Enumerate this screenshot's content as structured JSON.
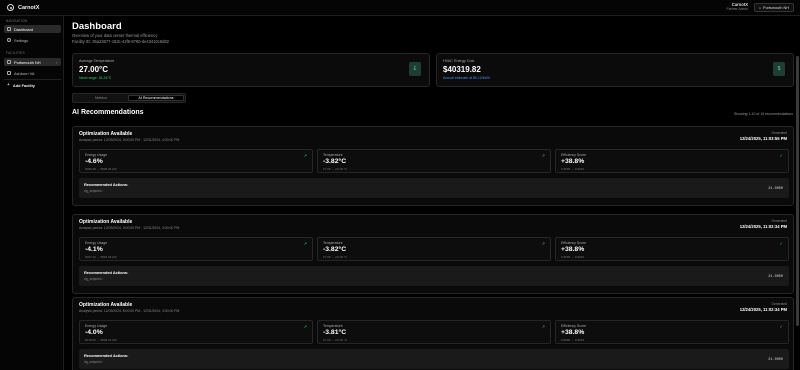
{
  "app": {
    "name": "CarnotX"
  },
  "user": {
    "name": "CarnotX",
    "role": "Partner Admin"
  },
  "facility_selector": {
    "label": "Portsmouth NH"
  },
  "sidebar": {
    "navigation_title": "NAVIGATION",
    "nav": [
      {
        "label": "Dashboard",
        "icon": "dashboard-icon",
        "active": true
      },
      {
        "label": "Settings",
        "icon": "settings-icon",
        "active": false
      }
    ],
    "facilities_title": "FACILITIES",
    "facilities": [
      {
        "label": "Portsmouth NH",
        "icon": "building-icon",
        "active": true
      },
      {
        "label": "Ashburn VA",
        "icon": "building-icon",
        "active": false
      }
    ],
    "add_facility": "Add Facility"
  },
  "header": {
    "title": "Dashboard",
    "subtitle": "Overview of your data center thermal efficiency",
    "facility_id": "Facility ID: 35a23677-153c-42f8-8780-de43410c9d82"
  },
  "stats": [
    {
      "label": "Average Temperature",
      "value": "27.00°C",
      "note": "Ideal range: 18-24°C",
      "note_color": "#3ec46d",
      "badge": "£"
    },
    {
      "label": "HVAC Energy Cost",
      "value": "$40319.82",
      "note": "Annual estimate at $0.12/kWh",
      "note_color": "#4f8ff0",
      "badge": "$"
    }
  ],
  "tabs": [
    {
      "label": "Metrics",
      "active": false
    },
    {
      "label": "AI Recommendations",
      "active": true
    }
  ],
  "recommendations": {
    "title": "AI Recommendations",
    "count_text": "Showing 1-10 of 19 recommendations",
    "cards": [
      {
        "title": "Optimization Available",
        "period": "Analysis period: 12/03/2024, 9:00:00 PM - 12/31/2024, 4:00:00 PM",
        "generated_label": "Generated",
        "generated_time": "12/24/2025, 11:03:55 PM",
        "metrics": [
          {
            "label": "Energy Usage",
            "value": "-4.6%",
            "range": "6080.48 → 5805.32 kW"
          },
          {
            "label": "Temperature",
            "value": "-3.82°C",
            "range": "27.00 → 23.18 °C"
          },
          {
            "label": "Efficiency Score",
            "value": "+38.8%",
            "range": "0.6593 → 0.9156"
          }
        ],
        "actions_title": "Recommended Actions:",
        "actions_text": "rtg_setpoint=",
        "actions_value": "21.0000"
      },
      {
        "title": "Optimization Available",
        "period": "Analysis period: 12/03/2024, 9:00:00 PM - 12/31/2024, 3:00:00 PM",
        "generated_label": "Generated",
        "generated_time": "12/24/2025, 11:02:34 PM",
        "metrics": [
          {
            "label": "Energy Usage",
            "value": "-4.1%",
            "range": "6067.44 → 5819.18 kW"
          },
          {
            "label": "Temperature",
            "value": "-3.82°C",
            "range": "27.00 → 23.18 °C"
          },
          {
            "label": "Efficiency Score",
            "value": "+38.8%",
            "range": "0.6593 → 0.9156"
          }
        ],
        "actions_title": "Recommended Actions:",
        "actions_text": "rtg_setpoint=",
        "actions_value": "21.0000"
      },
      {
        "title": "Optimization Available",
        "period": "Analysis period: 12/03/2024, 8:00:00 PM - 12/31/2024, 3:00:00 PM",
        "generated_label": "Generated",
        "generated_time": "12/24/2025, 11:02:34 PM",
        "metrics": [
          {
            "label": "Energy Usage",
            "value": "-4.0%",
            "range": "6079.05 → 5836.21 kW"
          },
          {
            "label": "Temperature",
            "value": "-3.81°C",
            "range": "27.00 → 23.19 °C"
          },
          {
            "label": "Efficiency Score",
            "value": "+38.8%",
            "range": "0.6593 → 0.9156"
          }
        ],
        "actions_title": "Recommended Actions:",
        "actions_text": "rtg_setpoint=",
        "actions_value": "21.0000"
      }
    ]
  }
}
